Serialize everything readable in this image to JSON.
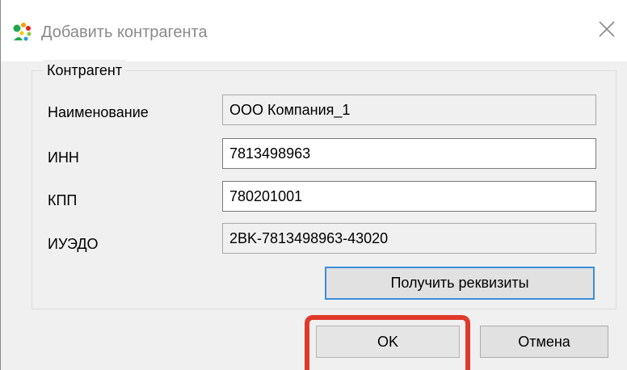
{
  "window": {
    "title": "Добавить контрагента",
    "app_icon": "app-logo-icon",
    "close_icon": "close-icon"
  },
  "group": {
    "title": "Контрагент"
  },
  "fields": {
    "name": {
      "label": "Наименование",
      "value": "ООО Компания_1"
    },
    "inn": {
      "label": "ИНН",
      "value": "7813498963"
    },
    "kpp": {
      "label": "КПП",
      "value": "780201001"
    },
    "iuedo": {
      "label": "ИУЭДО",
      "value": "2BK-7813498963-43020"
    }
  },
  "buttons": {
    "get_requisites": "Получить реквизиты",
    "ok": "OK",
    "cancel": "Отмена"
  },
  "colors": {
    "highlight": "#e0392b",
    "focus_border": "#3c8fd6"
  }
}
